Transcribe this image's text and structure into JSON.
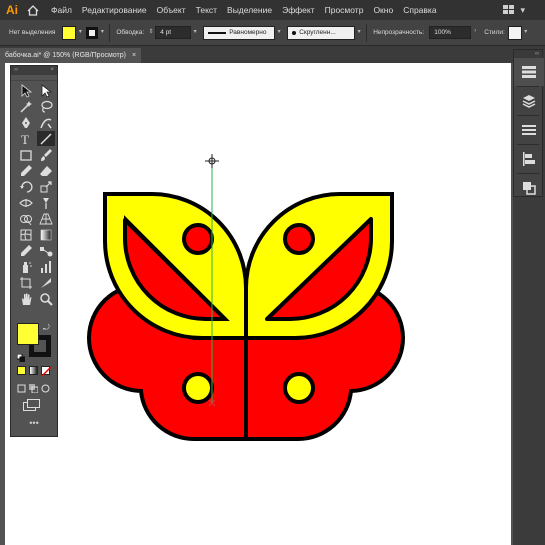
{
  "app": {
    "logo": "Ai"
  },
  "menu": [
    "Файл",
    "Редактирование",
    "Объект",
    "Текст",
    "Выделение",
    "Эффект",
    "Просмотр",
    "Окно",
    "Справка"
  ],
  "control_bar": {
    "selection_label": "Нет выделения",
    "stroke_label": "Обводка:",
    "stroke_weight": "4 pt",
    "profile_label": "Равномерно",
    "brush_label": "Скругленн...",
    "opacity_label": "Непрозрачность:",
    "opacity_value": "100%",
    "styles_label": "Стили:"
  },
  "document": {
    "tab_title": "бабочка.ai* @ 150% (RGB/Просмотр)",
    "close_glyph": "×"
  },
  "colors": {
    "fill": "#ffff33",
    "stroke": "#111111",
    "wing_yellow": "#ffff00",
    "wing_red": "#ff0000",
    "guide": "#2bb34a",
    "accent": "#ff9a00"
  },
  "tools": [
    "selection-tool",
    "direct-selection-tool",
    "magic-wand-tool",
    "lasso-tool",
    "pen-tool",
    "curvature-tool",
    "type-tool",
    "line-segment-tool",
    "rectangle-tool",
    "paintbrush-tool",
    "pencil-tool",
    "eraser-tool",
    "rotate-tool",
    "scale-tool",
    "width-tool",
    "puppet-warp-tool",
    "shape-builder-tool",
    "perspective-grid-tool",
    "mesh-tool",
    "gradient-tool",
    "eyedropper-tool",
    "blend-tool",
    "symbol-sprayer-tool",
    "column-graph-tool",
    "artboard-tool",
    "slice-tool",
    "hand-tool",
    "zoom-tool"
  ],
  "toolbar_more": "•••",
  "right_panels": [
    "properties-icon",
    "layers-icon",
    "libraries-icon",
    "align-icon",
    "pathfinder-icon"
  ]
}
